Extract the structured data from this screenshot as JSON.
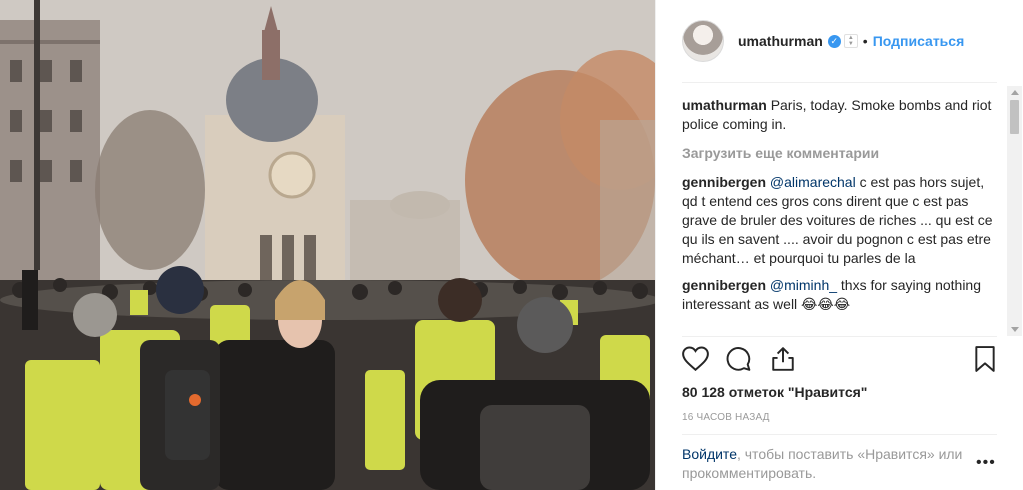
{
  "post": {
    "username": "umathurman",
    "verified_icon": "check-icon",
    "follow_label": "Подписаться",
    "separator": "•"
  },
  "comments": [
    {
      "user": "umathurman",
      "mention": "",
      "text": "Paris, today. Smoke bombs and riot police coming in."
    },
    {
      "user": "gennibergen",
      "mention": "@alimarechal",
      "text": " c est pas hors sujet, qd t entend ces gros cons dirent que c est pas grave de bruler des voitures de riches ... qu est ce qu ils en savent .... avoir du pognon c est pas etre méchant… et pourquoi tu parles de la"
    },
    {
      "user": "gennibergen",
      "mention": "@miminh_",
      "text": " thxs for saying nothing interessant as well 😂😂😂"
    }
  ],
  "load_more_label": "Загрузить еще комментарии",
  "icons": [
    "heart-icon",
    "comment-icon",
    "share-icon",
    "bookmark-icon"
  ],
  "likes_label": "80 128 отметок \"Нравится\"",
  "time_label": "16 ЧАСОВ НАЗАД",
  "login": {
    "link": "Войдите",
    "text": ", чтобы поставить «Нравится» или прокомментировать."
  },
  "more_label": "•••",
  "colors": {
    "accent": "#3897f0",
    "text": "#262626",
    "muted": "#999999",
    "link": "#003569"
  }
}
